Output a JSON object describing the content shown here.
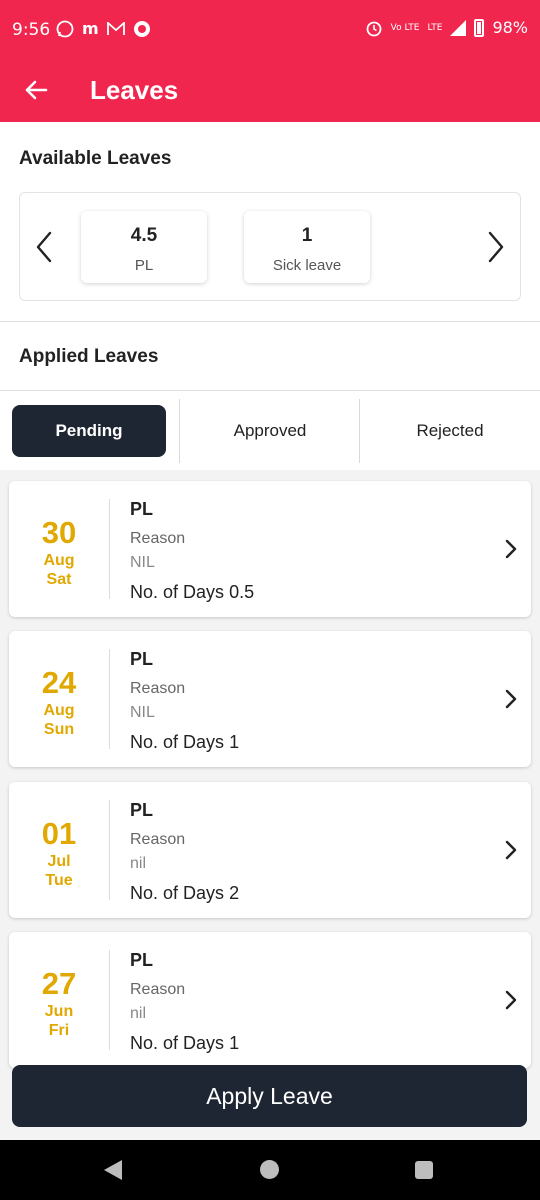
{
  "status_bar": {
    "time": "9:56",
    "battery": "98%",
    "volte": "Vo LTE",
    "lte": "LTE",
    "left_icons": [
      "whatsapp-icon",
      "m-icon",
      "gmail-icon",
      "whatsapp-business-icon"
    ],
    "right_icons": [
      "alarm-icon",
      "volte-icon",
      "signal-icon",
      "battery-icon"
    ]
  },
  "app_bar": {
    "title": "Leaves",
    "back_icon": "arrow-left-icon",
    "color": "#f0264f"
  },
  "available_leaves": {
    "title": "Available Leaves",
    "items": [
      {
        "value": "4.5",
        "label": "PL"
      },
      {
        "value": "1",
        "label": "Sick leave"
      }
    ]
  },
  "applied_leaves": {
    "title": "Applied Leaves",
    "tabs": [
      {
        "label": "Pending",
        "selected": true
      },
      {
        "label": "Approved",
        "selected": false
      },
      {
        "label": "Rejected",
        "selected": false
      }
    ],
    "list": [
      {
        "day": "30",
        "month": "Aug",
        "weekday": "Sat",
        "type": "PL",
        "reason_label": "Reason",
        "reason": "NIL",
        "days_label": "No. of Days",
        "days": "0.5"
      },
      {
        "day": "24",
        "month": "Aug",
        "weekday": "Sun",
        "type": "PL",
        "reason_label": "Reason",
        "reason": "NIL",
        "days_label": "No. of Days",
        "days": "1"
      },
      {
        "day": "01",
        "month": "Jul",
        "weekday": "Tue",
        "type": "PL",
        "reason_label": "Reason",
        "reason": "nil",
        "days_label": "No. of Days",
        "days": "2"
      },
      {
        "day": "27",
        "month": "Jun",
        "weekday": "Fri",
        "type": "PL",
        "reason_label": "Reason",
        "reason": "nil",
        "days_label": "No. of Days",
        "days": "1"
      }
    ]
  },
  "apply_button": {
    "label": "Apply Leave"
  },
  "colors": {
    "accent": "#f0264f",
    "dark": "#1f2633",
    "date": "#e0a800"
  }
}
